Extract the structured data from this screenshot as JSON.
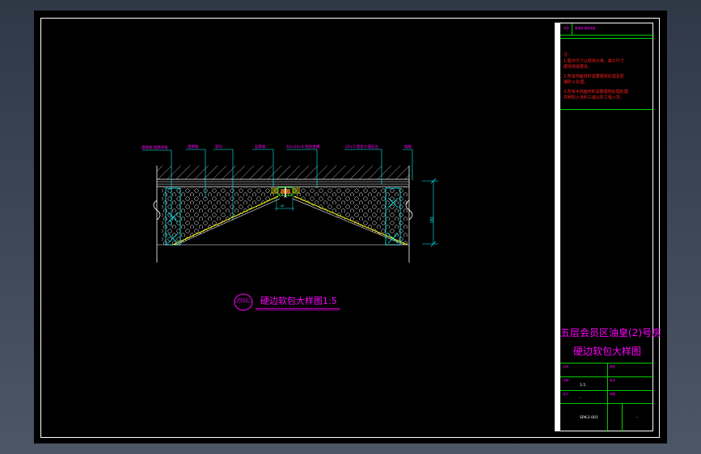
{
  "drawing": {
    "title": "硬边软包大样图1:5",
    "detail_tag": "PX01",
    "callouts": [
      "阻燃板 阻燃夹板",
      "阻燃板",
      "软包",
      "石膏板",
      "40×24×8 铝合金槽",
      "20×5 铝合大理石边",
      "墙纸"
    ],
    "dim_vertical": "360",
    "dim_small": "40"
  },
  "title_block": {
    "header_left": "项目",
    "header_right": "阻燃板 阻燃夹板",
    "notes": [
      "注：",
      "1.图中尺寸以现场为准，施工尺寸",
      "  据现场需要定。",
      "2.所有饰面材料需要阻燃处理及防",
      "  潮防火处理。",
      "3.所有木饰面材料需要阻燃处理处理",
      "  并刷防火涂料三遍以防工程火灾。"
    ],
    "project_title_1": "五层会员区油皇(2)号房",
    "project_title_2": "硬边软包大样图",
    "rows": [
      {
        "label": "比例",
        "value": "",
        "label2": "图号"
      },
      {
        "label": "日期",
        "value": "1:5",
        "label2": "版次"
      },
      {
        "label": "设计",
        "value": "-",
        "label2": "审核"
      },
      {
        "label": "",
        "value": "SPK-2-001",
        "label2": "",
        "value2": "-"
      }
    ]
  },
  "colors": {
    "frame": "#ffffff",
    "callout": "#ff00ff",
    "dimension": "#00ffff",
    "notes": "#ff2020",
    "grid": "#00d000",
    "yellow": "#ffff00"
  }
}
